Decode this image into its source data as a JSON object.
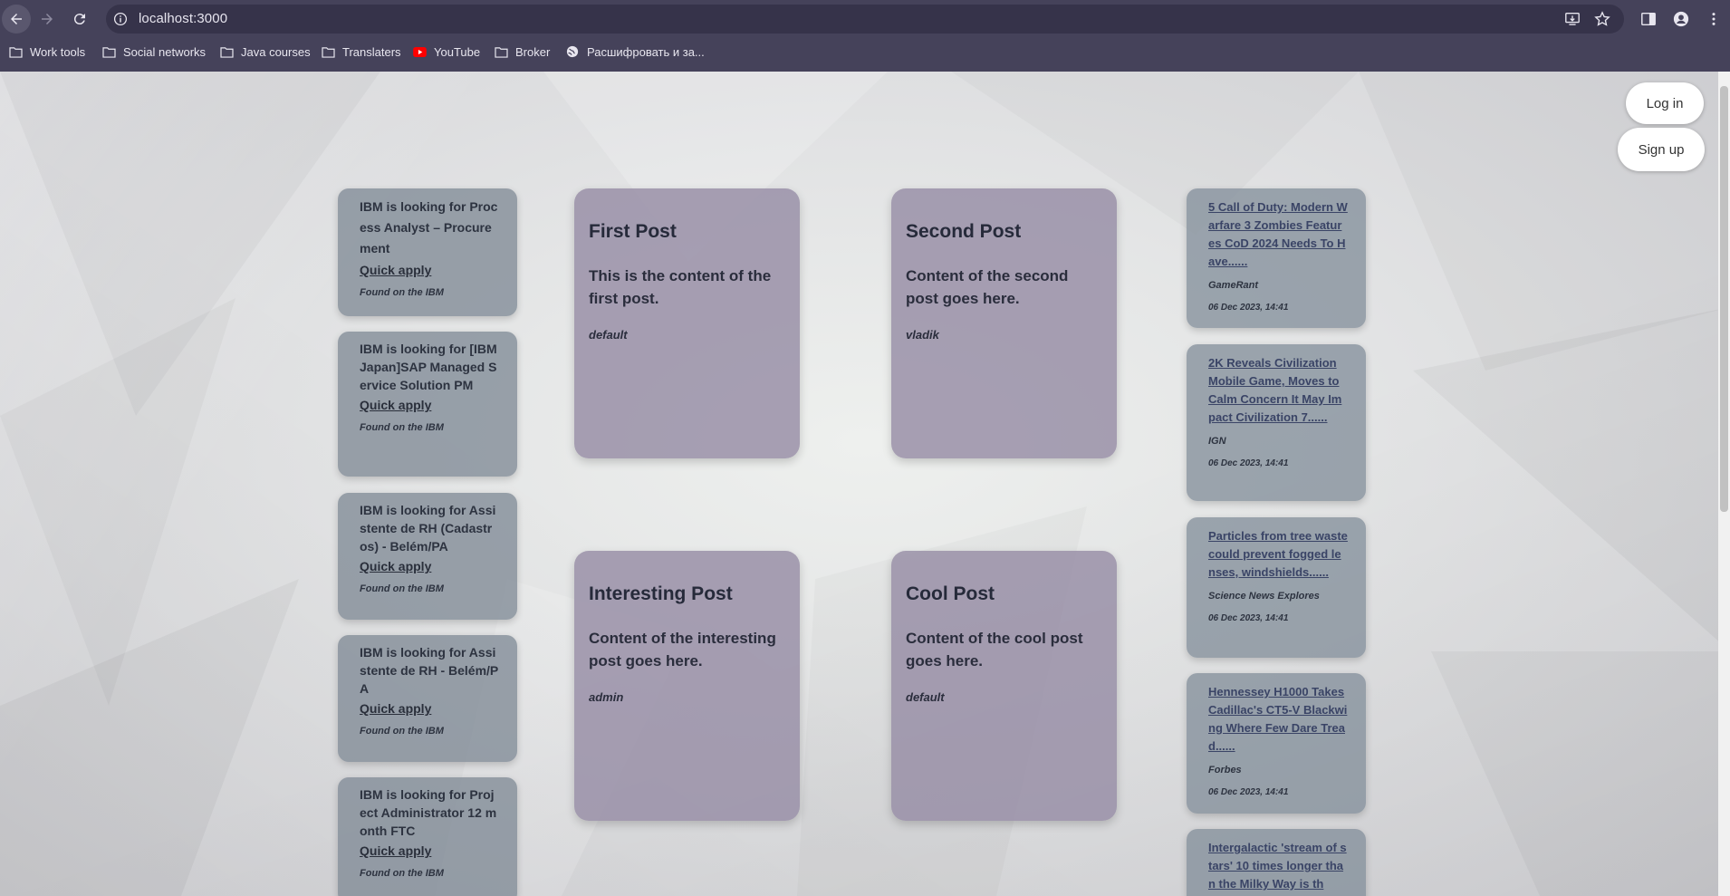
{
  "browser": {
    "url": "localhost:3000",
    "bookmarks": [
      {
        "label": "Work tools",
        "icon": "folder-icon"
      },
      {
        "label": "Social networks",
        "icon": "folder-icon"
      },
      {
        "label": "Java courses",
        "icon": "folder-icon"
      },
      {
        "label": "Translaters",
        "icon": "folder-icon"
      },
      {
        "label": "YouTube",
        "icon": "youtube-icon"
      },
      {
        "label": "Broker",
        "icon": "folder-icon"
      },
      {
        "label": "Расшифровать и за...",
        "icon": "globe-icon"
      }
    ]
  },
  "auth": {
    "login_label": "Log in",
    "signup_label": "Sign up"
  },
  "jobs": [
    {
      "title": "IBM is looking for Process Analyst – Procurement",
      "apply": "Quick apply",
      "found": "Found on the IBM"
    },
    {
      "title": "IBM is looking for [IBM Japan]SAP Managed Service Solution PM",
      "apply": "Quick apply",
      "found": "Found on the IBM"
    },
    {
      "title": "IBM is looking for Assistente de RH (Cadastros) - Belém/PA",
      "apply": "Quick apply",
      "found": "Found on the IBM"
    },
    {
      "title": "IBM is looking for Assistente de RH - Belém/PA",
      "apply": "Quick apply",
      "found": "Found on the IBM"
    },
    {
      "title": "IBM is looking for Project Administrator 12 month FTC",
      "apply": "Quick apply",
      "found": "Found on the IBM"
    }
  ],
  "posts": [
    {
      "title": "First Post",
      "content": "This is the content of the first post.",
      "author": "default"
    },
    {
      "title": "Second Post",
      "content": "Content of the second post goes here.",
      "author": "vladik"
    },
    {
      "title": "Interesting Post",
      "content": "Content of the interesting post goes here.",
      "author": "admin"
    },
    {
      "title": "Cool Post",
      "content": "Content of the cool post goes here.",
      "author": "default"
    }
  ],
  "news": [
    {
      "title": "5 Call of Duty: Modern Warfare 3 Zombies Features CoD 2024 Needs To Have......",
      "source": "GameRant",
      "date": "06 Dec 2023, 14:41"
    },
    {
      "title": "2K Reveals Civilization Mobile Game, Moves to Calm Concern It May Impact Civilization 7......",
      "source": "IGN",
      "date": "06 Dec 2023, 14:41"
    },
    {
      "title": "Particles from tree waste could prevent fogged lenses, windshields......",
      "source": "Science News Explores",
      "date": "06 Dec 2023, 14:41"
    },
    {
      "title": "Hennessey H1000 Takes Cadillac's CT5-V Blackwing Where Few Dare Tread......",
      "source": "Forbes",
      "date": "06 Dec 2023, 14:41"
    },
    {
      "title": "Intergalactic 'stream of stars' 10 times longer than the Milky Way is th",
      "source": "",
      "date": ""
    }
  ]
}
